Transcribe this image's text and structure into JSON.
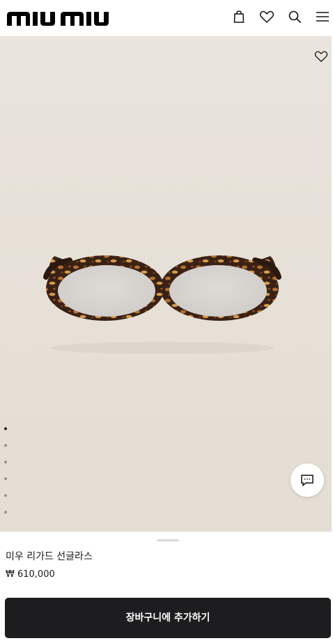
{
  "header": {
    "brand": "miu miu",
    "icons": [
      "bag-icon",
      "heart-icon",
      "search-icon",
      "menu-icon"
    ]
  },
  "hero": {
    "image_subject": "tortoiseshell oval glasses",
    "favorite_icon": "heart-icon",
    "carousel": {
      "count": 6,
      "active_index": 0
    },
    "chat_icon": "chat-bubble-icon"
  },
  "product": {
    "name": "미우 리가드 선글라스",
    "price": "₩ 610,000"
  },
  "cta": {
    "add_to_cart_label": "장바구니에 추가하기"
  },
  "colors": {
    "background": "#ffffff",
    "hero_bg": "#e7e2da",
    "button_bg": "#1d1d1f",
    "button_text": "#ffffff",
    "text": "#1a1a1a"
  }
}
